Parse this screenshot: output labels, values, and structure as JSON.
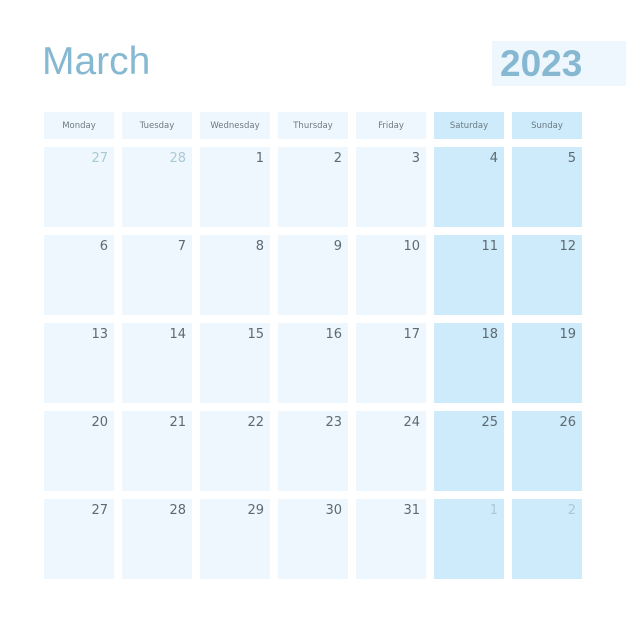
{
  "header": {
    "month": "March",
    "year": "2023"
  },
  "colors": {
    "accent": "#86b8d2",
    "weekday_bg": "#eef7fd",
    "weekend_bg": "#cdebfb",
    "date_text": "#5e6a72",
    "muted_text": "#aac9d6"
  },
  "weekdays": [
    "Monday",
    "Tuesday",
    "Wednesday",
    "Thursday",
    "Friday",
    "Saturday",
    "Sunday"
  ],
  "weeks": [
    [
      {
        "d": "27",
        "muted": true
      },
      {
        "d": "28",
        "muted": true
      },
      {
        "d": "1"
      },
      {
        "d": "2"
      },
      {
        "d": "3"
      },
      {
        "d": "4"
      },
      {
        "d": "5"
      }
    ],
    [
      {
        "d": "6"
      },
      {
        "d": "7"
      },
      {
        "d": "8"
      },
      {
        "d": "9"
      },
      {
        "d": "10"
      },
      {
        "d": "11"
      },
      {
        "d": "12"
      }
    ],
    [
      {
        "d": "13"
      },
      {
        "d": "14"
      },
      {
        "d": "15"
      },
      {
        "d": "16"
      },
      {
        "d": "17"
      },
      {
        "d": "18"
      },
      {
        "d": "19"
      }
    ],
    [
      {
        "d": "20"
      },
      {
        "d": "21"
      },
      {
        "d": "22"
      },
      {
        "d": "23"
      },
      {
        "d": "24"
      },
      {
        "d": "25"
      },
      {
        "d": "26"
      }
    ],
    [
      {
        "d": "27"
      },
      {
        "d": "28"
      },
      {
        "d": "29"
      },
      {
        "d": "30"
      },
      {
        "d": "31"
      },
      {
        "d": "1",
        "muted": true
      },
      {
        "d": "2",
        "muted": true
      }
    ]
  ]
}
